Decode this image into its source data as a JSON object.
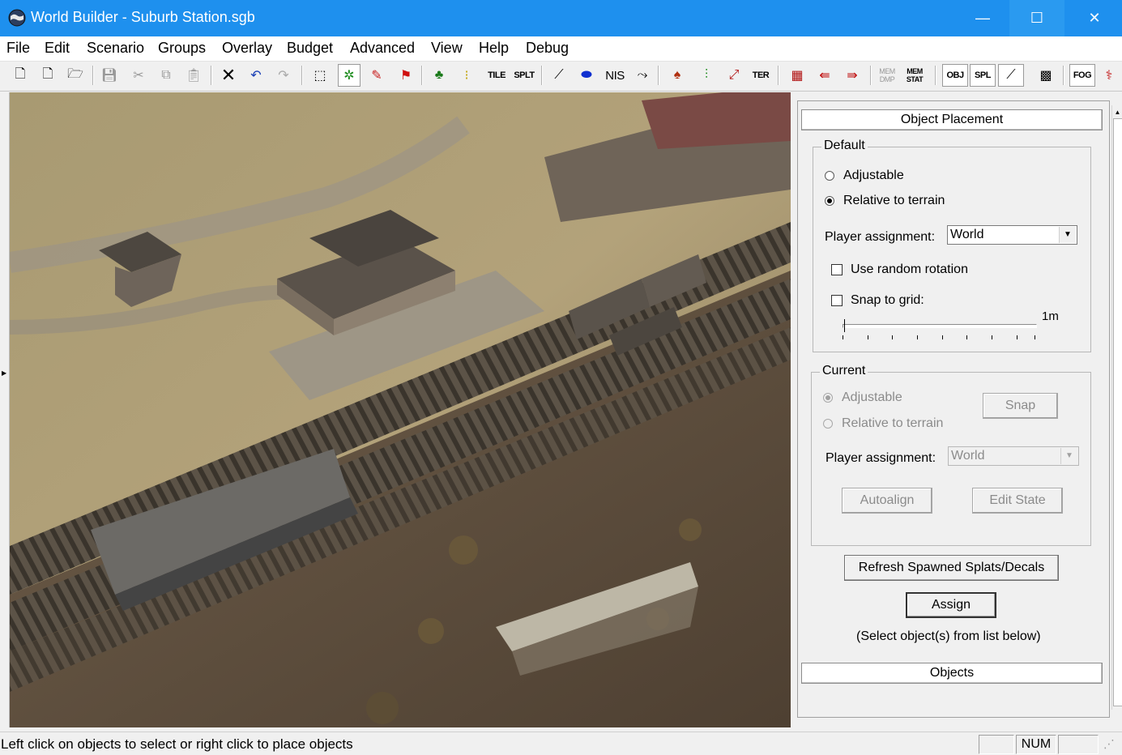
{
  "window": {
    "title": "World Builder - Suburb Station.sgb",
    "min_label": "—",
    "max_label": "☐",
    "close_label": "✕"
  },
  "menu": [
    "File",
    "Edit",
    "Scenario",
    "Groups",
    "Overlay",
    "Budget",
    "Advanced",
    "View",
    "Help",
    "Debug"
  ],
  "toolbar": {
    "tile": "TILE",
    "splt": "SPLT",
    "nis": "NIS",
    "ter": "TER",
    "mem_dmp": "MEM DMP",
    "mem_stat": "MEM STAT",
    "obj": "OBJ",
    "spl": "SPL",
    "fog": "FOG"
  },
  "panel": {
    "header": "Object Placement",
    "default": {
      "legend": "Default",
      "adjustable": "Adjustable",
      "relative": "Relative to terrain",
      "player_label": "Player assignment:",
      "player_value": "World",
      "random_rotation": "Use random rotation",
      "snap_grid": "Snap to grid:",
      "grid_value": "1m"
    },
    "current": {
      "legend": "Current",
      "adjustable": "Adjustable",
      "relative": "Relative to terrain",
      "snap": "Snap",
      "player_label": "Player assignment:",
      "player_value": "World",
      "autoalign": "Autoalign",
      "edit_state": "Edit State"
    },
    "refresh": "Refresh Spawned Splats/Decals",
    "assign": "Assign",
    "hint": "(Select object(s) from list below)",
    "objects_header": "Objects"
  },
  "status": {
    "text": "Left click on objects to select or right click to place objects",
    "num": "NUM"
  }
}
